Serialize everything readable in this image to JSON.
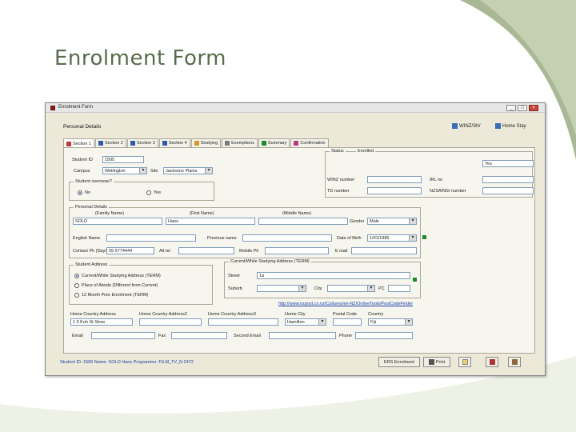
{
  "slide": {
    "title": "Enrolment Form"
  },
  "window": {
    "title": "Enrolment Form",
    "buttons": {
      "minimize": "_",
      "maximize": "□",
      "close": "×"
    }
  },
  "header": {
    "section_title": "Personal Details",
    "link_a": "WINZ/StV",
    "link_b": "Home Stay"
  },
  "tabs": [
    {
      "label": "Section 1",
      "icon": "form-icon"
    },
    {
      "label": "Section 2",
      "icon": "form-icon"
    },
    {
      "label": "Section 3",
      "icon": "form-icon"
    },
    {
      "label": "Section 4",
      "icon": "form-icon"
    },
    {
      "label": "Studying",
      "icon": "book-icon"
    },
    {
      "label": "Exemptions",
      "icon": "list-icon"
    },
    {
      "label": "Summary",
      "icon": "grid-icon"
    },
    {
      "label": "Confirmation",
      "icon": "pen-icon"
    }
  ],
  "form": {
    "student_id_label": "Student ID",
    "student_id_value": "1505",
    "campus_label": "Campus",
    "campus_value": "Wellington",
    "site_label": "Site",
    "site_value": "Jacksons Plains",
    "status_cap": "Status",
    "status_value": "Enrolled",
    "flag_value": "Yes",
    "winz_label": "WINZ number",
    "winz_value": "",
    "irl_label": "IRL no",
    "irl_value": "",
    "td_label": "TD number",
    "td_value": "",
    "nsn_label": "NZSA/NSI number",
    "nsn_value": "",
    "student_overseas_cap": "Student overseas?",
    "radio_no": "No",
    "radio_yes": "Yes",
    "personal_cap": "Personal Details",
    "family_name_label": "(Family Name)",
    "family_name_value": "SOLO",
    "first_name_label": "(First Name)",
    "first_name_value": "Hans",
    "middle_name_label": "(Middle Name)",
    "middle_name_value": "",
    "gender_label": "Gender",
    "gender_value": "Male",
    "english_name_label": "English Name",
    "english_name_value": "",
    "previous_name_label": "Previous name",
    "previous_name_value": "",
    "dob_label": "Date of Birth",
    "dob_value": "1/01/1985",
    "contact_label": "Contact Ph (Day/Eve)",
    "contact_value": "09 5774444",
    "alt_tel_label": "Alt tel",
    "alt_tel_value": "",
    "mobile_label": "Mobile Ph",
    "mobile_value": "",
    "email_label": "E mail",
    "email_value": "",
    "student_address_cap": "Student Address",
    "addr_opt1": "Current/While Studying Address (TERM)",
    "addr_opt2": "Place of Abode (Different from Current)",
    "addr_opt3": "12 Month Prior Enrolment (TERM)",
    "current_addr_cap": "Current/While Studying Address (TERM)",
    "street_label": "Street",
    "street_value": "1a",
    "suburb_label": "Suburb",
    "suburb_value": "",
    "city_label": "City",
    "city_value": "",
    "pc_label": "PC",
    "pc_value": "",
    "map_link": "http://www.nzpost.co.nz/Cultures/en-NZ/OnlineTools/PostCodeFinder",
    "home_addr1_label": "Home Country Address",
    "home_addr1_value": "1 5 Koh St Stree",
    "home_addr2_label": "Home Country Address2",
    "home_addr2_value": "",
    "home_addr3_label": "Home Country Address3",
    "home_addr3_value": "",
    "home_city_label": "Home City",
    "home_city_value": "Hamilton",
    "postal_code_label": "Postal Code",
    "postal_code_value": "",
    "country_label": "Country",
    "country_value": "Fiji",
    "email2_label": "Email",
    "email2_value": "",
    "fax_label": "Fax",
    "fax_value": "",
    "second_email_label": "Second Email",
    "second_email_value": "",
    "phone_label": "Phone",
    "phone_value": ""
  },
  "statusbar": {
    "text": "Student ID: 1505  Name: SOLO Hans  Programme: FILM_TV_N 2472",
    "ers_label": "ERS Enrolment",
    "print_label": "Print"
  }
}
